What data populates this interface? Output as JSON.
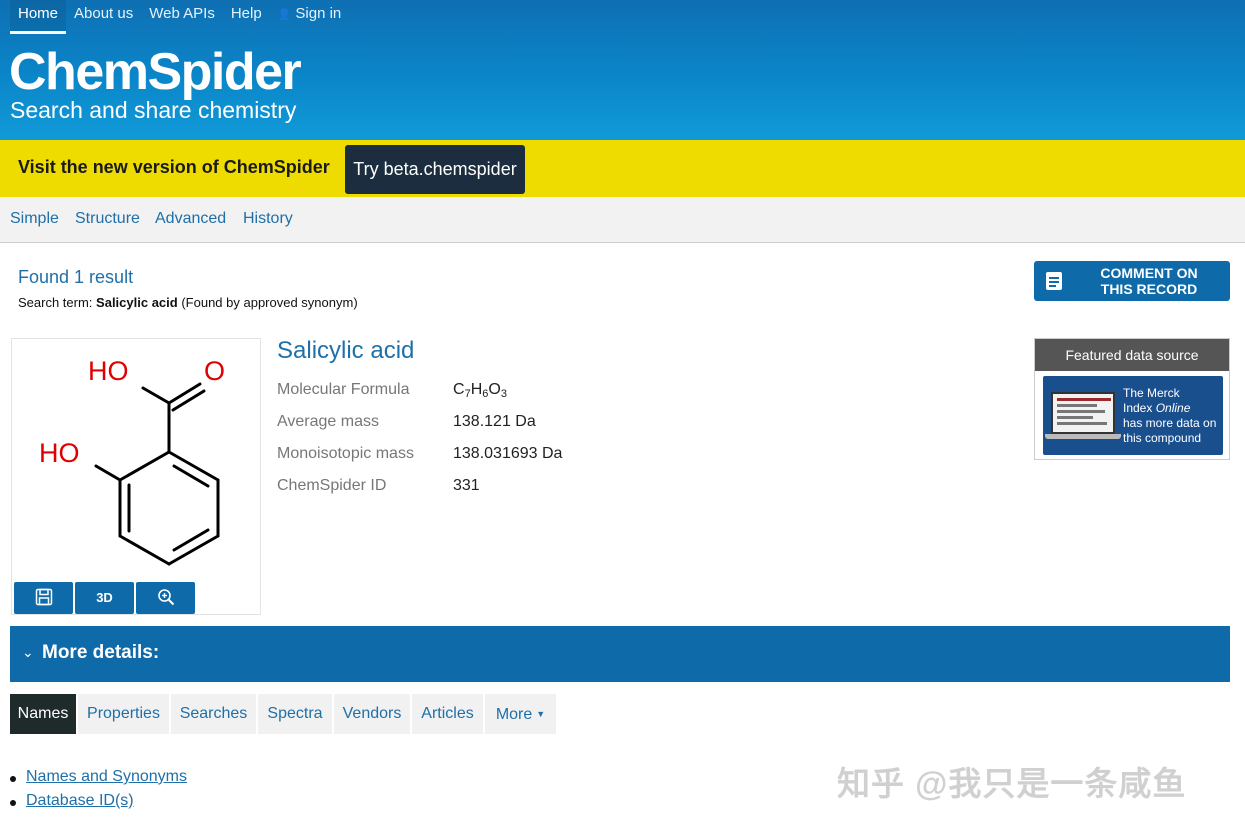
{
  "top_nav": {
    "items": [
      "Home",
      "About us",
      "Web APIs",
      "Help"
    ],
    "sign_in": "Sign in"
  },
  "brand": {
    "logo": "ChemSpider",
    "tagline": "Search and share chemistry"
  },
  "banner": {
    "text": "Visit the new version of ChemSpider",
    "button": "Try beta.chemspider",
    "color": "#eedc00"
  },
  "search_tabs": [
    "Simple",
    "Structure",
    "Advanced",
    "History"
  ],
  "result": {
    "found": "Found 1 result",
    "term_prefix": "Search term:",
    "term": "Salicylic acid",
    "term_suffix": "(Found by approved synonym)"
  },
  "comment_button": "COMMENT ON THIS RECORD",
  "structure": {
    "atom_labels": [
      "HO",
      "O",
      "HO"
    ],
    "buttons": [
      "save-icon",
      "3D",
      "zoom-icon"
    ],
    "button_3d_label": "3D"
  },
  "compound": {
    "name": "Salicylic acid",
    "properties": [
      {
        "label": "Molecular Formula",
        "value": "C7H6O3"
      },
      {
        "label": "Average mass",
        "value": "138.121 Da"
      },
      {
        "label": "Monoisotopic mass",
        "value": "138.031693 Da"
      },
      {
        "label": "ChemSpider ID",
        "value": "331"
      }
    ],
    "formula_parts": {
      "c": "C",
      "c_n": "7",
      "h": "H",
      "h_n": "6",
      "o": "O",
      "o_n": "3"
    }
  },
  "featured": {
    "heading": "Featured data source",
    "line1": "The Merck",
    "line2": "Index",
    "line2_italic": "Online",
    "line3": "has more data on",
    "line4": "this compound"
  },
  "more_details": "More details:",
  "detail_tabs": [
    "Names",
    "Properties",
    "Searches",
    "Spectra",
    "Vendors",
    "Articles",
    "More"
  ],
  "active_tab": "Names",
  "links": [
    "Names and Synonyms",
    "Database ID(s)"
  ],
  "watermark": "知乎 @我只是一条咸鱼",
  "colors": {
    "header": "#0a86c9",
    "link": "#1f6fa8",
    "button": "#0e6aa8",
    "atom": "#e00000"
  }
}
